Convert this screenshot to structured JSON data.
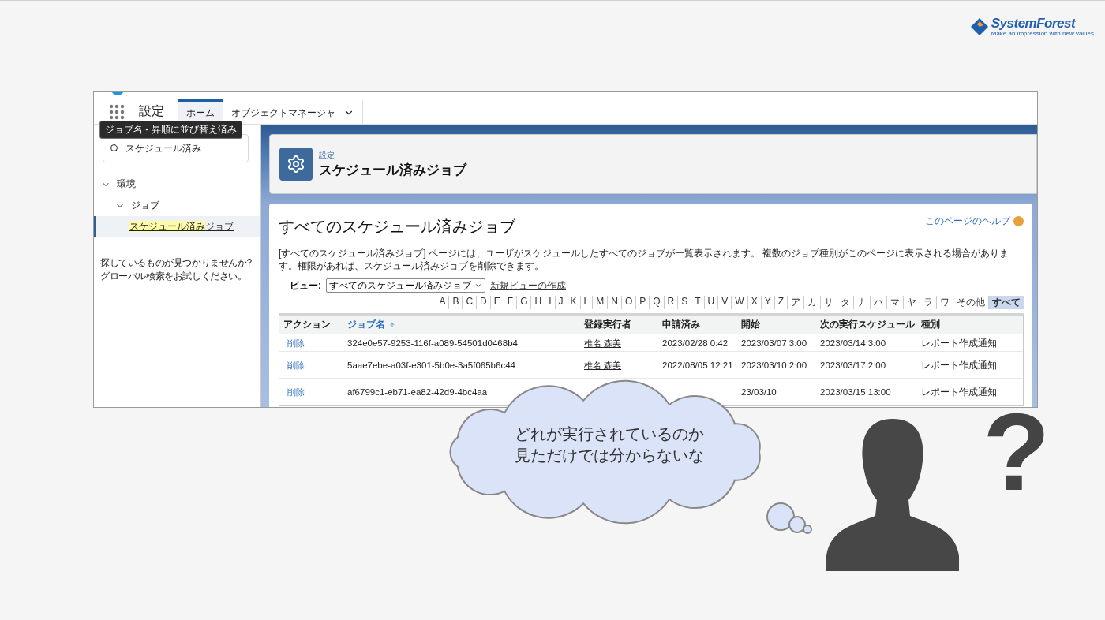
{
  "logo": {
    "name": "SystemForest",
    "tagline": "Make an impression with new values"
  },
  "app": {
    "title": "設定",
    "tabs": [
      {
        "label": "ホーム",
        "selected": true,
        "has_menu": false
      },
      {
        "label": "オブジェクトマネージャ",
        "selected": false,
        "has_menu": true
      }
    ]
  },
  "tooltip": "ジョブ名 - 昇順に並び替え済み",
  "sidebar": {
    "search": {
      "value": "スケジュール済み"
    },
    "tree": [
      {
        "label": "環境",
        "expanded": true,
        "children": [
          {
            "label": "ジョブ",
            "expanded": true,
            "children": [
              {
                "highlighted": "スケジュール済み",
                "label": "ジョブ",
                "selected": true
              }
            ]
          }
        ]
      }
    ],
    "hint": [
      "探しているものが見つかりませんか?",
      "グローバル検索をお試しください。"
    ]
  },
  "header": {
    "breadcrumb": "設定",
    "title": "スケジュール済みジョブ"
  },
  "content": {
    "title": "すべてのスケジュール済みジョブ",
    "help_link": "このページのヘルプ",
    "description": "[すべてのスケジュール済みジョブ] ページには、ユーザがスケジュールしたすべてのジョブが一覧表示されます。 複数のジョブ種別がこのページに表示される場合があります。権限があれば、スケジュール済みジョブを削除できます。",
    "view": {
      "label": "ビュー:",
      "value": "すべてのスケジュール済みジョブ",
      "new_view_link": "新規ビューの作成"
    },
    "alphabet": [
      {
        "label": "A",
        "selected": false
      },
      {
        "label": "B",
        "selected": false
      },
      {
        "label": "C",
        "selected": false
      },
      {
        "label": "D",
        "selected": false
      },
      {
        "label": "E",
        "selected": false
      },
      {
        "label": "F",
        "selected": false
      },
      {
        "label": "G",
        "selected": false
      },
      {
        "label": "H",
        "selected": false
      },
      {
        "label": "I",
        "selected": false
      },
      {
        "label": "J",
        "selected": false
      },
      {
        "label": "K",
        "selected": false
      },
      {
        "label": "L",
        "selected": false
      },
      {
        "label": "M",
        "selected": false
      },
      {
        "label": "N",
        "selected": false
      },
      {
        "label": "O",
        "selected": false
      },
      {
        "label": "P",
        "selected": false
      },
      {
        "label": "Q",
        "selected": false
      },
      {
        "label": "R",
        "selected": false
      },
      {
        "label": "S",
        "selected": false
      },
      {
        "label": "T",
        "selected": false
      },
      {
        "label": "U",
        "selected": false
      },
      {
        "label": "V",
        "selected": false
      },
      {
        "label": "W",
        "selected": false
      },
      {
        "label": "X",
        "selected": false
      },
      {
        "label": "Y",
        "selected": false
      },
      {
        "label": "Z",
        "selected": false
      },
      {
        "label": "ア",
        "selected": false
      },
      {
        "label": "カ",
        "selected": false
      },
      {
        "label": "サ",
        "selected": false
      },
      {
        "label": "タ",
        "selected": false
      },
      {
        "label": "ナ",
        "selected": false
      },
      {
        "label": "ハ",
        "selected": false
      },
      {
        "label": "マ",
        "selected": false
      },
      {
        "label": "ヤ",
        "selected": false
      },
      {
        "label": "ラ",
        "selected": false
      },
      {
        "label": "ワ",
        "selected": false
      },
      {
        "label": "その他",
        "selected": false
      },
      {
        "label": "すべて",
        "selected": true
      }
    ],
    "table": {
      "columns": [
        {
          "label": "アクション",
          "sorted": false
        },
        {
          "label": "ジョブ名",
          "sorted": true
        },
        {
          "label": "登録実行者",
          "sorted": false
        },
        {
          "label": "申請済み",
          "sorted": false
        },
        {
          "label": "開始",
          "sorted": false
        },
        {
          "label": "次の実行スケジュール",
          "sorted": false
        },
        {
          "label": "種別",
          "sorted": false
        }
      ],
      "rows": [
        {
          "action": "削除",
          "job": "324e0e57-9253-116f-a089-54501d0468b4",
          "user": "椎名 森美",
          "submitted": "2023/02/28 0:42",
          "start": "2023/03/07 3:00",
          "next": "2023/03/14 3:00",
          "type": "レポート作成通知"
        },
        {
          "action": "削除",
          "job": "5aae7ebe-a03f-e301-5b0e-3a5f065b6c44",
          "user": "椎名 森美",
          "submitted": "2022/08/05 12:21",
          "start": "2023/03/10 2:00",
          "next": "2023/03/17 2:00",
          "type": "レポート作成通知"
        },
        {
          "action": "削除",
          "job": "af6799c1-eb71-ea82-42d9-4bc4aa",
          "start": "23/03/10",
          "next": "2023/03/15 13:00",
          "type": "レポート作成通知"
        }
      ]
    }
  },
  "thought": {
    "lines": [
      "どれが実行されているのか",
      "見ただけでは分からないな"
    ],
    "mark": "?"
  }
}
